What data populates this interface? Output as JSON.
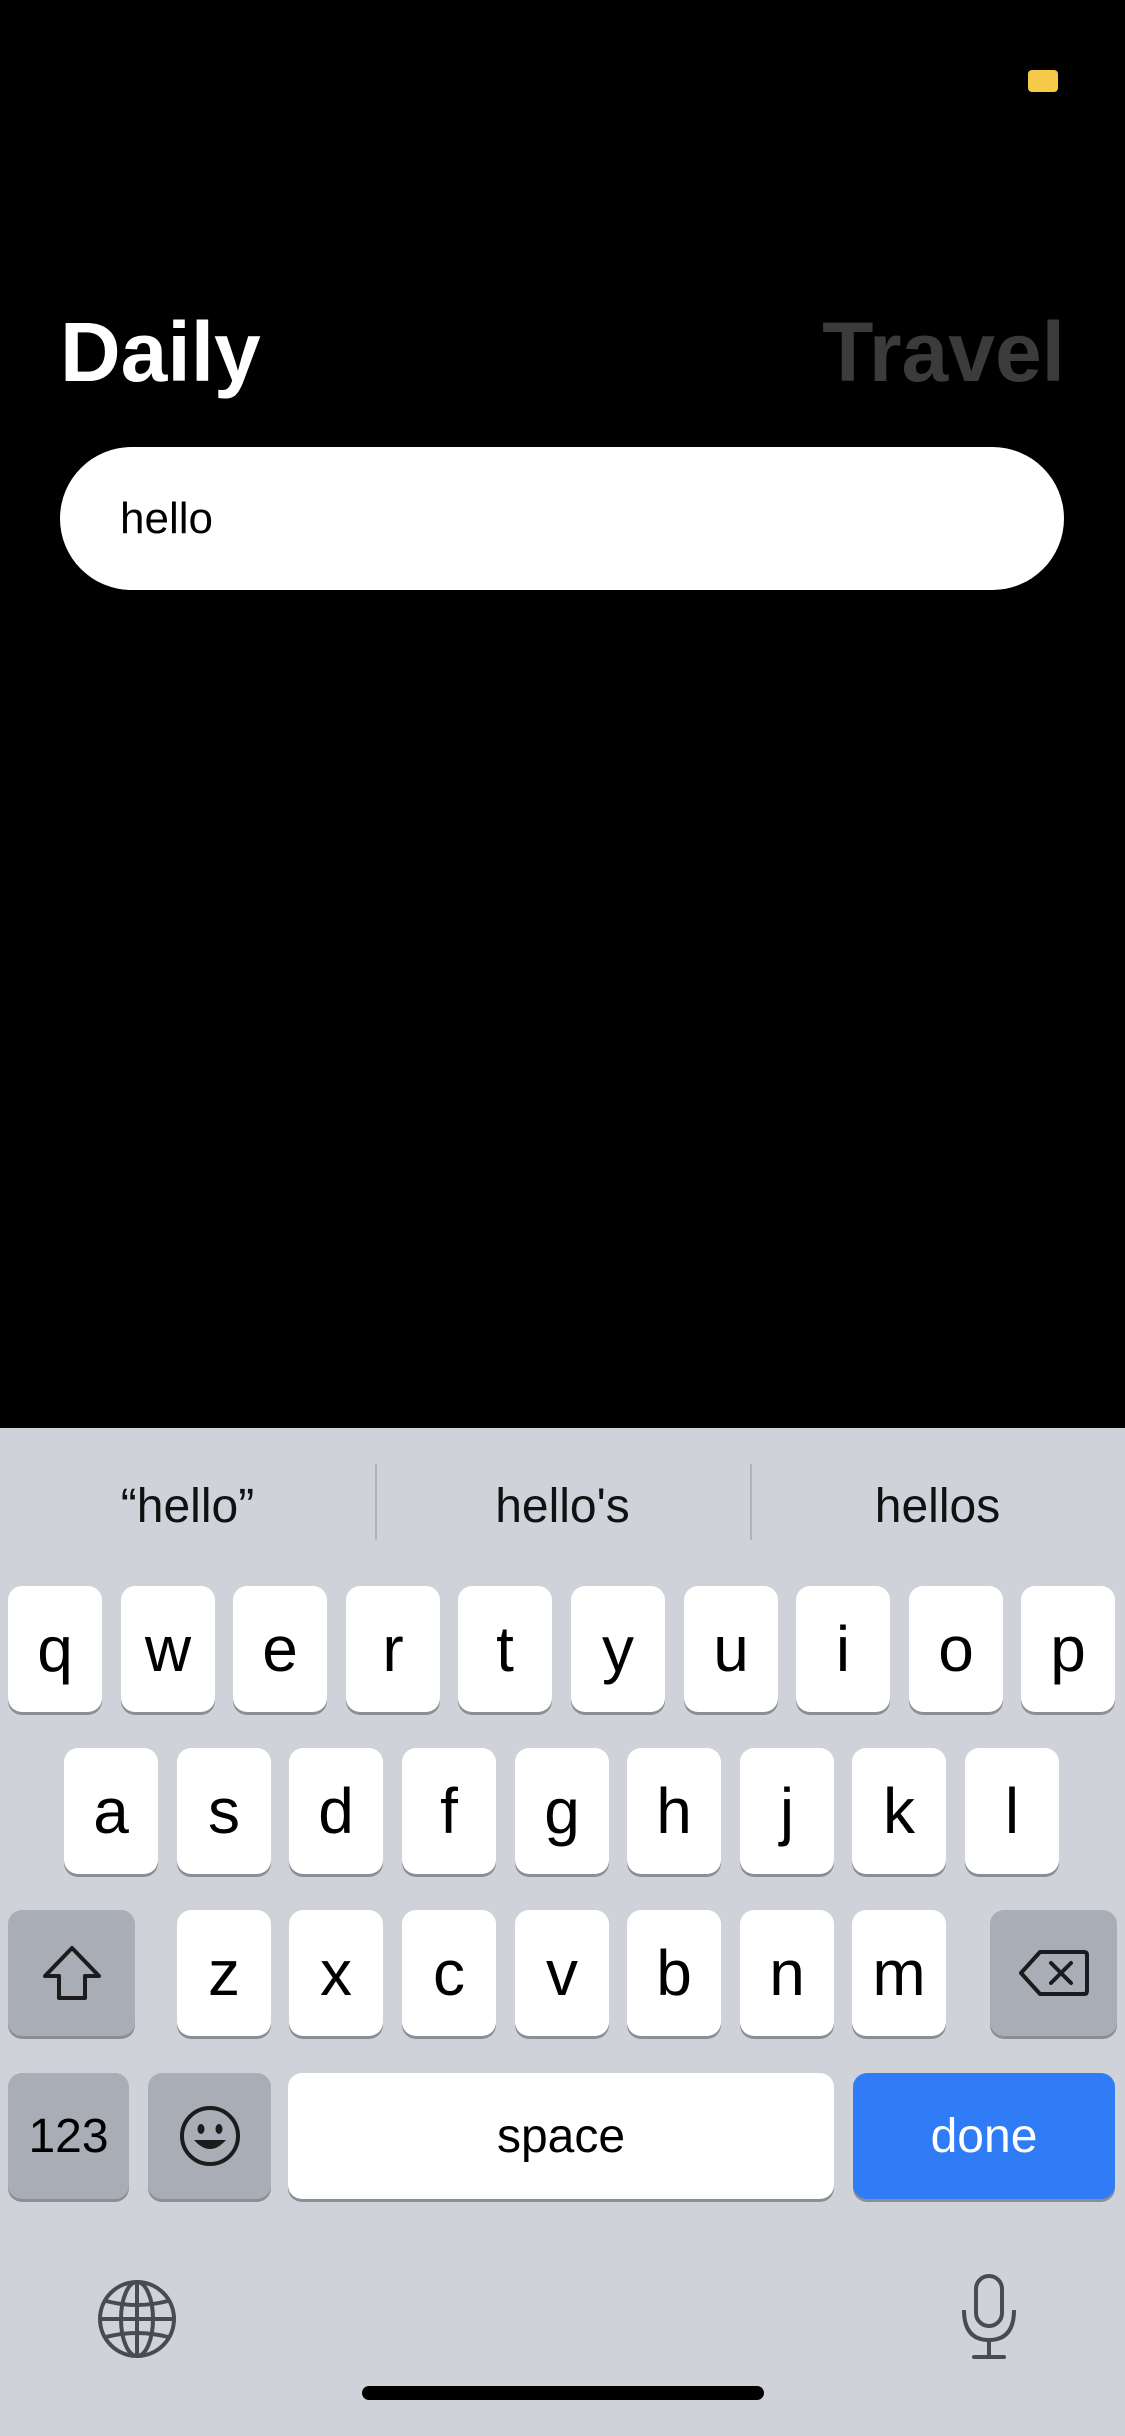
{
  "header": {
    "tab_daily": "Daily",
    "tab_travel": "Travel",
    "status_indicator_color": "#f7c948"
  },
  "search": {
    "value": "hello"
  },
  "keyboard": {
    "suggestions": [
      "“hello”",
      "hello's",
      "hellos"
    ],
    "row1": [
      "q",
      "w",
      "e",
      "r",
      "t",
      "y",
      "u",
      "i",
      "o",
      "p"
    ],
    "row2": [
      "a",
      "s",
      "d",
      "f",
      "g",
      "h",
      "j",
      "k",
      "l"
    ],
    "row3": [
      "z",
      "x",
      "c",
      "v",
      "b",
      "n",
      "m"
    ],
    "numbers_label": "123",
    "space_label": "space",
    "done_label": "done",
    "icons": {
      "shift": "shift-icon",
      "delete": "delete-icon",
      "emoji": "emoji-icon",
      "globe": "globe-icon",
      "microphone": "microphone-icon"
    },
    "accent_color": "#2f7cf6"
  }
}
